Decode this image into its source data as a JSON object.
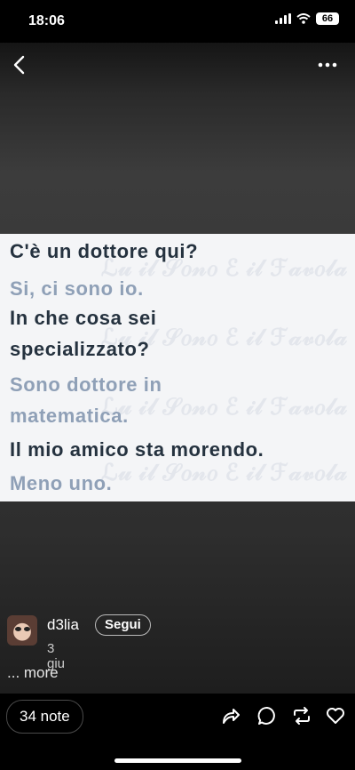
{
  "status": {
    "time": "18:06",
    "battery": "66"
  },
  "nav": {
    "back_icon": "chevron-left-icon",
    "more_icon": "ellipsis-icon"
  },
  "quote_lines": [
    {
      "text": "C'è un dottore qui?",
      "tone": "dark"
    },
    {
      "text": "Si, ci sono io.",
      "tone": "light"
    },
    {
      "text": "In che cosa sei",
      "tone": "dark"
    },
    {
      "text": "specializzato?",
      "tone": "dark"
    },
    {
      "text": "Sono dottore in",
      "tone": "light"
    },
    {
      "text": "matematica.",
      "tone": "light"
    },
    {
      "text": "Il mio amico sta morendo.",
      "tone": "dark"
    },
    {
      "text": "Meno uno.",
      "tone": "light"
    }
  ],
  "author": {
    "name": "d3lia",
    "follow_label": "Segui",
    "date": "3 giu"
  },
  "caption": {
    "more_label": "... more"
  },
  "footer": {
    "notes_label": "34 note",
    "actions": [
      "share-icon",
      "reply-icon",
      "reblog-icon",
      "like-icon"
    ]
  },
  "colors": {
    "dark_text": "#25323f",
    "light_text": "#8fa0b7",
    "card_bg": "#f4f5f7"
  }
}
